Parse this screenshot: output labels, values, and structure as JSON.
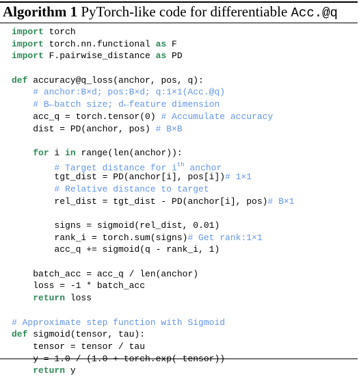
{
  "caption": {
    "label": "Algorithm 1",
    "text": "PyTorch-like code for differentiable",
    "code": "Acc.@q"
  },
  "code_lines": [
    [
      {
        "t": "import",
        "c": "kw"
      },
      {
        "t": " torch"
      }
    ],
    [
      {
        "t": "import",
        "c": "kw"
      },
      {
        "t": " torch.nn.functional "
      },
      {
        "t": "as",
        "c": "kw"
      },
      {
        "t": " F"
      }
    ],
    [
      {
        "t": "import",
        "c": "kw"
      },
      {
        "t": " F.pairwise_distance "
      },
      {
        "t": "as",
        "c": "kw"
      },
      {
        "t": " PD"
      }
    ],
    [],
    [
      {
        "t": "def",
        "c": "kw"
      },
      {
        "t": " accuracy@q_loss(anchor, pos, q):"
      }
    ],
    [
      {
        "t": "    "
      },
      {
        "t": "# anchor:B×d; pos:B×d; q:1×1(Acc.@q)",
        "c": "cm"
      }
    ],
    [
      {
        "t": "    "
      },
      {
        "t": "# B←batch size; d←feature dimension",
        "c": "cm"
      }
    ],
    [
      {
        "t": "    acc_q = torch.tensor(0) "
      },
      {
        "t": "# Accumulate accuracy",
        "c": "cm"
      }
    ],
    [
      {
        "t": "    dist = PD(anchor, pos) "
      },
      {
        "t": "# B×B",
        "c": "cm"
      }
    ],
    [],
    [
      {
        "t": "    "
      },
      {
        "t": "for",
        "c": "kw"
      },
      {
        "t": " i "
      },
      {
        "t": "in",
        "c": "kw"
      },
      {
        "t": " range(len(anchor)):"
      }
    ],
    [
      {
        "t": "        "
      },
      {
        "t": "# Target distance for i",
        "c": "cm"
      },
      {
        "t": "th",
        "c": "cm sup"
      },
      {
        "t": " anchor",
        "c": "cm"
      }
    ],
    [
      {
        "t": "        tgt_dist = PD(anchor[i], pos[i])"
      },
      {
        "t": "# 1×1",
        "c": "cm"
      }
    ],
    [
      {
        "t": "        "
      },
      {
        "t": "# Relative distance to target",
        "c": "cm"
      }
    ],
    [
      {
        "t": "        rel_dist = tgt_dist - PD(anchor[i], pos)"
      },
      {
        "t": "# B×1",
        "c": "cm"
      }
    ],
    [],
    [
      {
        "t": "        signs = sigmoid(rel_dist, 0.01)"
      }
    ],
    [
      {
        "t": "        rank_i = torch.sum(signs)"
      },
      {
        "t": "# Get rank:1×1",
        "c": "cm"
      }
    ],
    [
      {
        "t": "        acc_q += sigmoid(q - rank_i, 1)"
      }
    ],
    [],
    [
      {
        "t": "    batch_acc = acc_q / len(anchor)"
      }
    ],
    [
      {
        "t": "    loss = -1 * batch_acc"
      }
    ],
    [
      {
        "t": "    "
      },
      {
        "t": "return",
        "c": "kw"
      },
      {
        "t": " loss"
      }
    ],
    [],
    [
      {
        "t": "# Approximate step function with Sigmoid",
        "c": "cm"
      }
    ],
    [
      {
        "t": "def",
        "c": "kw"
      },
      {
        "t": " sigmoid(tensor, tau):"
      }
    ],
    [
      {
        "t": "    tensor = tensor / tau"
      }
    ],
    [
      {
        "t": "    y = 1.0 / (1.0 + torch.exp(-tensor))"
      }
    ],
    [
      {
        "t": "    "
      },
      {
        "t": "return",
        "c": "kw"
      },
      {
        "t": " y"
      }
    ]
  ]
}
